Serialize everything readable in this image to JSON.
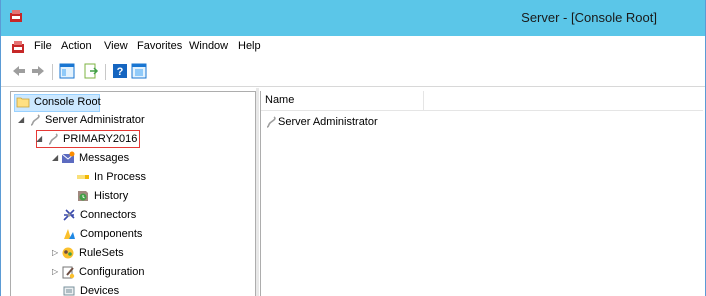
{
  "window": {
    "title": "Server - [Console Root]"
  },
  "menu": [
    "File",
    "Action",
    "View",
    "Favorites",
    "Window",
    "Help"
  ],
  "toolbar": {
    "icons": [
      "back-arrow-icon",
      "forward-arrow-icon",
      "show-hide-tree-icon",
      "export-list-icon",
      "help-icon",
      "properties-icon"
    ]
  },
  "tree": {
    "root": "Console Root",
    "server_admin": "Server Administrator",
    "primary": "PRIMARY2016",
    "messages": "Messages",
    "in_process": "In Process",
    "history": "History",
    "connectors": "Connectors",
    "components": "Components",
    "rulesets": "RuleSets",
    "configuration": "Configuration",
    "devices": "Devices"
  },
  "list": {
    "column_name": "Name",
    "items": [
      "Server Administrator"
    ]
  },
  "colors": {
    "titlebar": "#5bc6e8",
    "selection": "#cce8ff",
    "highlight_box": "#e53935"
  }
}
